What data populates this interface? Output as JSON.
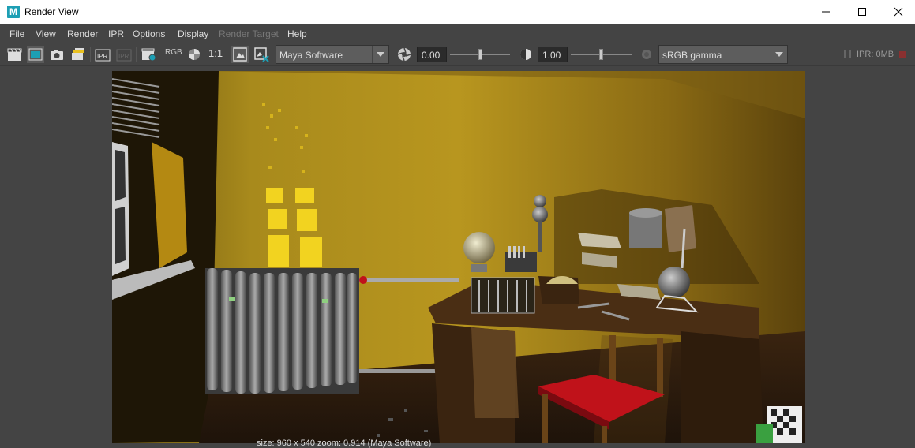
{
  "window": {
    "title": "Render View",
    "app_icon_letter": "M"
  },
  "menu": {
    "items": [
      {
        "label": "File",
        "enabled": true
      },
      {
        "label": "View",
        "enabled": true
      },
      {
        "label": "Render",
        "enabled": true
      },
      {
        "label": "IPR",
        "enabled": true
      },
      {
        "label": "Options",
        "enabled": true
      },
      {
        "label": "Display",
        "enabled": true
      },
      {
        "label": "Render Target",
        "enabled": false
      },
      {
        "label": "Help",
        "enabled": true
      }
    ]
  },
  "toolbar": {
    "rgb_label": "RGB",
    "ratio_label": "1:1",
    "renderer": "Maya Software",
    "exposure": "0.00",
    "gamma": "1.00",
    "color_space": "sRGB gamma",
    "ipr_memory": "IPR: 0MB"
  },
  "render_info": "size: 960 x 540  zoom: 0.914  (Maya Software)",
  "colors": {
    "wall": "#b8921f",
    "chair_seat": "#c0121a",
    "accent": "#1d9fb4"
  }
}
